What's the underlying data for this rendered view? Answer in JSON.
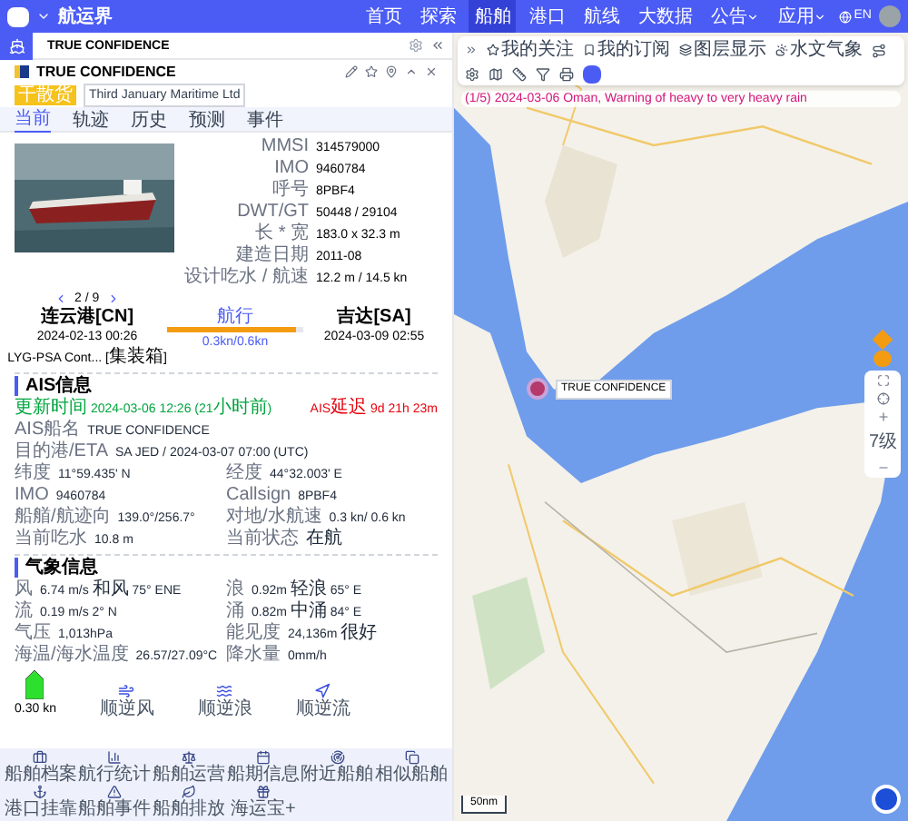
{
  "top_bar": {
    "title": "航运界",
    "nav": [
      {
        "label": "首页",
        "selected": false,
        "dropdown": false
      },
      {
        "label": "探索",
        "selected": false,
        "dropdown": false
      },
      {
        "label": "船舶",
        "selected": true,
        "dropdown": false
      },
      {
        "label": "港口",
        "selected": false,
        "dropdown": false
      },
      {
        "label": "航线",
        "selected": false,
        "dropdown": false
      },
      {
        "label": "大数据",
        "selected": false,
        "dropdown": false
      },
      {
        "label": "公告",
        "selected": false,
        "dropdown": true
      },
      {
        "label": "应用",
        "selected": false,
        "dropdown": true
      }
    ],
    "language": "EN"
  },
  "search": {
    "value": "TRUE CONFIDENCE"
  },
  "ship": {
    "name": "TRUE CONFIDENCE",
    "type_tag": "干散货",
    "company": "Third January Maritime Ltd",
    "tabs": [
      {
        "label": "当前",
        "selected": true
      },
      {
        "label": "轨迹",
        "selected": false
      },
      {
        "label": "历史",
        "selected": false
      },
      {
        "label": "预测",
        "selected": false
      },
      {
        "label": "事件",
        "selected": false
      }
    ],
    "details": [
      {
        "label": "MMSI",
        "value": "314579000"
      },
      {
        "label": "IMO",
        "value": "9460784"
      },
      {
        "label": "呼号",
        "value": "8PBF4"
      },
      {
        "label": "DWT/GT",
        "value": "50448 / 29104"
      },
      {
        "label": "长 * 宽",
        "value": "183.0 x 32.3 m"
      },
      {
        "label": "建造日期",
        "value": "2011-08"
      },
      {
        "label": "设计吃水 / 航速",
        "value": "12.2 m / 14.5 kn"
      }
    ],
    "photo_pager": "2 / 9"
  },
  "voyage": {
    "departure": {
      "port": "连云港[CN]",
      "time": "2024-02-13 00:26",
      "terminal": "LYG-PSA Cont... [集装箱]"
    },
    "status": "航行",
    "level": 0.95,
    "speed": "0.3kn/0.6kn",
    "arrival": {
      "port": "吉达[SA]",
      "time": "2024-03-09 02:55"
    }
  },
  "ais": {
    "title": "AIS信息",
    "updated": {
      "label": "更新时间",
      "value": "2024-03-06 12:26 (21小时前)"
    },
    "delay": "AIS延迟 9d 21h 23m",
    "name": {
      "label": "AIS船名",
      "value": "TRUE CONFIDENCE"
    },
    "eta": {
      "label": "目的港/ETA",
      "value": "SA JED / 2024-03-07 07:00 (UTC)"
    },
    "rows": [
      [
        {
          "label": "纬度",
          "value": "11°59.435' N"
        },
        {
          "label": "经度",
          "value": "44°32.003' E"
        }
      ],
      [
        {
          "label": "IMO",
          "value": "9460784"
        },
        {
          "label": "Callsign",
          "value": "8PBF4"
        }
      ],
      [
        {
          "label": "船艏/航迹向",
          "value": "139.0°/256.7°"
        },
        {
          "label": "对地/水航速",
          "value": "0.3 kn/ 0.6 kn"
        }
      ],
      [
        {
          "label": "当前吃水",
          "value": "10.8 m"
        },
        {
          "label": "当前状态",
          "value": "在航"
        }
      ]
    ]
  },
  "weather": {
    "title": "气象信息",
    "rows": [
      [
        {
          "label": "风",
          "value": "6.74 m/s 和风 75° ENE"
        },
        {
          "label": "浪",
          "value": "0.92m 轻浪 65° E"
        }
      ],
      [
        {
          "label": "流",
          "value": "0.19 m/s 2° N"
        },
        {
          "label": "涌",
          "value": "0.82m 中涌 84° E"
        }
      ],
      [
        {
          "label": "气压",
          "value": "1,013hPa"
        },
        {
          "label": "能见度",
          "value": "24,136m 很好"
        }
      ],
      [
        {
          "label": "海温/海水温度",
          "value": "26.57/27.09°C"
        },
        {
          "label": "降水量",
          "value": "0mm/h"
        }
      ]
    ],
    "speed": "0.30 kn",
    "indicators": [
      "顺逆风",
      "顺逆浪",
      "顺逆流"
    ]
  },
  "tools": [
    "船舶档案",
    "航行统计",
    "船舶运营",
    "船期信息",
    "附近船舶",
    "相似船舶",
    "港口挂靠",
    "船舶事件",
    "船舶排放",
    "海运宝+"
  ],
  "map": {
    "toolbar": [
      "我的关注",
      "我的订阅",
      "图层显示",
      "水文气象"
    ],
    "alert": "(1/5) 2024-03-06 Oman, Warning of heavy to very heavy rain",
    "ship_label": "TRUE CONFIDENCE",
    "zoom_level": "7级",
    "scale": "50nm"
  }
}
